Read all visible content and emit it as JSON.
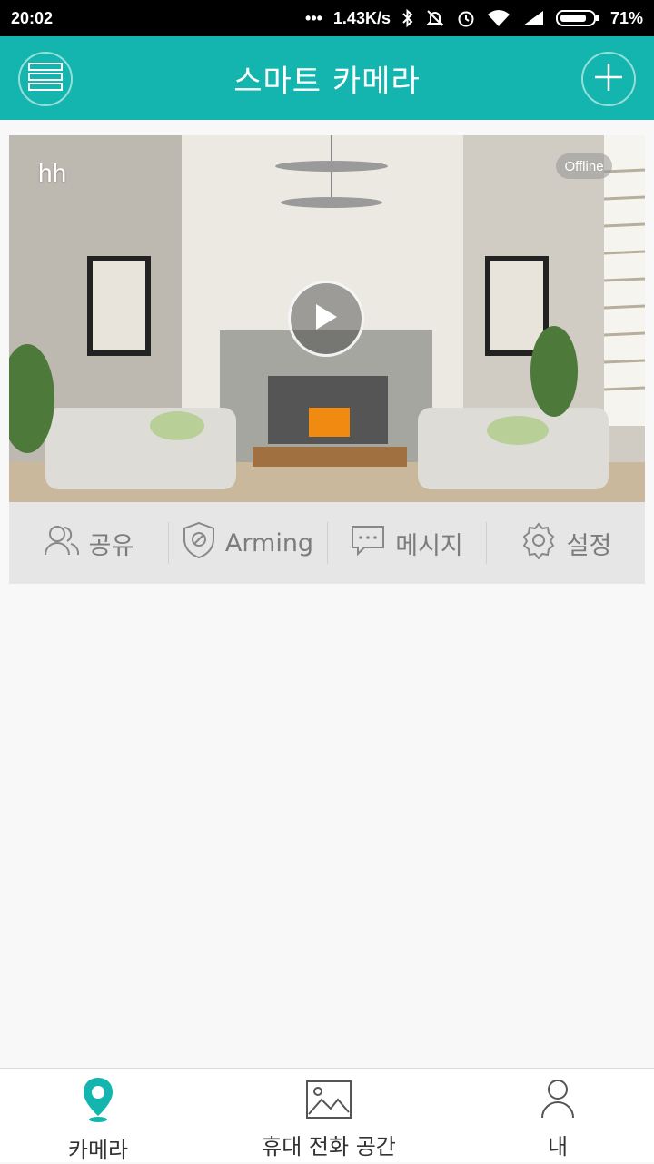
{
  "status_bar": {
    "time": "20:02",
    "network_speed": "1.43K/s",
    "battery": "71%"
  },
  "header": {
    "title": "스마트 카메라",
    "menu_icon": "list-icon",
    "add_icon": "plus-icon"
  },
  "camera": {
    "name": "hh",
    "status": "Offline"
  },
  "actions": [
    {
      "label": "공유",
      "icon": "users-icon"
    },
    {
      "label": "Arming",
      "icon": "shield-icon"
    },
    {
      "label": "메시지",
      "icon": "message-icon"
    },
    {
      "label": "설정",
      "icon": "gear-icon"
    }
  ],
  "bottom_nav": [
    {
      "label": "카메라",
      "icon": "location-pin-icon",
      "active": true
    },
    {
      "label": "휴대 전화 공간",
      "icon": "image-icon",
      "active": false
    },
    {
      "label": "내",
      "icon": "person-icon",
      "active": false
    }
  ],
  "colors": {
    "accent": "#14b5ae",
    "status_bar": "#000000",
    "card_bg": "#e6e6e6",
    "text_muted": "#7c7c7c"
  }
}
